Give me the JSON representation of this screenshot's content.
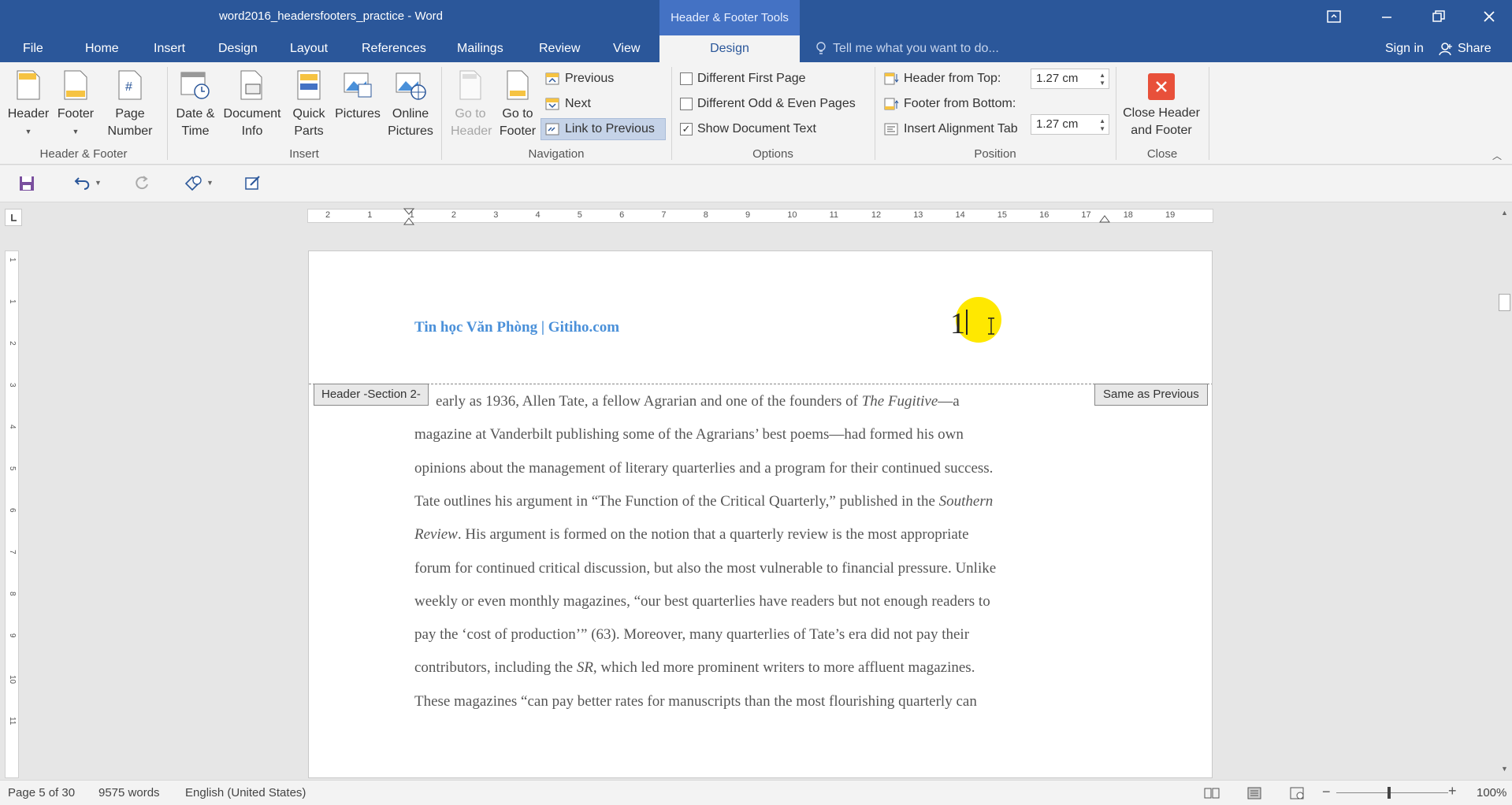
{
  "window": {
    "title": "word2016_headersfooters_practice - Word",
    "contextual_group": "Header & Footer Tools",
    "sign_in": "Sign in",
    "share": "Share"
  },
  "tabs": [
    "File",
    "Home",
    "Insert",
    "Design",
    "Layout",
    "References",
    "Mailings",
    "Review",
    "View"
  ],
  "active_tab": "Design",
  "tell_me_placeholder": "Tell me what you want to do...",
  "ribbon": {
    "header_footer": {
      "header": "Header",
      "footer": "Footer",
      "page_number": "Page Number",
      "label": "Header & Footer"
    },
    "insert": {
      "date_time": "Date & Time",
      "document_info": "Document Info",
      "quick_parts": "Quick Parts",
      "pictures": "Pictures",
      "online_pictures": "Online Pictures",
      "label": "Insert"
    },
    "navigation": {
      "go_to_header": "Go to Header",
      "go_to_footer": "Go to Footer",
      "previous": "Previous",
      "next": "Next",
      "link_to_previous": "Link to Previous",
      "label": "Navigation"
    },
    "options": {
      "different_first_page": "Different First Page",
      "different_odd_even": "Different Odd & Even Pages",
      "show_document_text": "Show Document Text",
      "different_first_page_checked": false,
      "different_odd_even_checked": false,
      "show_document_text_checked": true,
      "label": "Options"
    },
    "position": {
      "header_from_top": "Header from Top:",
      "header_from_top_value": "1.27 cm",
      "footer_from_bottom": "Footer from Bottom:",
      "footer_from_bottom_value": "1.27 cm",
      "insert_alignment_tab": "Insert Alignment Tab",
      "label": "Position"
    },
    "close": {
      "close_header_footer": "Close Header and Footer",
      "label": "Close"
    }
  },
  "ruler_numbers": [
    "2",
    "1",
    "1",
    "2",
    "3",
    "4",
    "5",
    "6",
    "7",
    "8",
    "9",
    "10",
    "11",
    "12",
    "13",
    "14",
    "15",
    "16",
    "17",
    "18",
    "19"
  ],
  "vruler_numbers": [
    "1",
    "1",
    "2",
    "3",
    "4",
    "5",
    "6",
    "7",
    "8",
    "9",
    "10",
    "11"
  ],
  "document": {
    "header_text": "Tin học Văn Phòng | Gitiho.com",
    "page_number": "1",
    "header_tag": "Header -Section 2-",
    "same_as_previous": "Same as Previous",
    "lines": [
      [
        {
          "t": "early as 1936, Allen Tate, a fellow Agrarian and one of the founders of "
        },
        {
          "t": "The Fugitive",
          "i": true
        },
        {
          "t": "—a"
        }
      ],
      [
        {
          "t": "magazine at Vanderbilt publishing some of the Agrarians’ best poems—had formed his own"
        }
      ],
      [
        {
          "t": "opinions about the management of literary quarterlies and a program for their continued success."
        }
      ],
      [
        {
          "t": "Tate outlines his argument in “The Function of the Critical Quarterly,” published in the "
        },
        {
          "t": "Southern",
          "i": true
        }
      ],
      [
        {
          "t": "Review",
          "i": true
        },
        {
          "t": ". His argument is formed on the notion that a quarterly review is the most appropriate"
        }
      ],
      [
        {
          "t": "forum for continued critical discussion, but also the most vulnerable to financial pressure. Unlike"
        }
      ],
      [
        {
          "t": "weekly or even monthly magazines, “our best quarterlies have readers but not enough readers to"
        }
      ],
      [
        {
          "t": "pay the ‘cost of production’” (63).  Moreover, many quarterlies of Tate’s era did not pay their"
        }
      ],
      [
        {
          "t": "contributors, including the "
        },
        {
          "t": "SR",
          "i": true
        },
        {
          "t": ", which led more prominent writers to more affluent magazines."
        }
      ],
      [
        {
          "t": "These magazines “can pay better rates for manuscripts than the most flourishing quarterly can"
        }
      ]
    ]
  },
  "status": {
    "page": "Page 5 of 30",
    "words": "9575 words",
    "language": "English (United States)",
    "zoom": "100%"
  },
  "colors": {
    "brand": "#2b579a",
    "accent_header_text": "#4a90d9",
    "close_red": "#e8503a",
    "cursor_highlight": "#ffe800"
  }
}
